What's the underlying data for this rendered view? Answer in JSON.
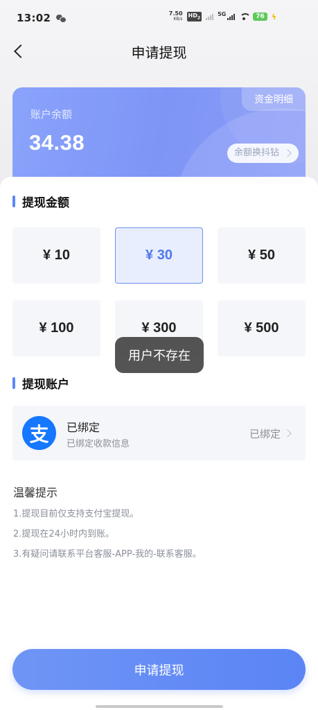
{
  "status_bar": {
    "time": "13:02",
    "net_speed_value": "7.50",
    "net_speed_unit": "KB/s",
    "hd_label": "HD",
    "hd_sub": "2",
    "network_label": "5G",
    "battery": "76"
  },
  "nav": {
    "title": "申请提现"
  },
  "balance_card": {
    "detail_label": "资金明细",
    "balance_label": "账户余额",
    "balance_value": "34.38",
    "exchange_label": "余额换抖钻"
  },
  "amount_section": {
    "title": "提现金额",
    "options": [
      "¥ 10",
      "¥ 30",
      "¥ 50",
      "¥ 100",
      "¥ 300",
      "¥ 500"
    ],
    "selected_index": 1
  },
  "account_section": {
    "title": "提现账户",
    "icon_glyph": "支",
    "account_title": "已绑定",
    "account_sub": "已绑定收款信息",
    "status": "已绑定"
  },
  "tips": {
    "title": "温馨提示",
    "items": [
      "1.提现目前仅支持支付宝提现。",
      "2.提现在24小时内到账。",
      "3.有疑问请联系平台客服-APP-我的-联系客服。"
    ]
  },
  "toast": {
    "message": "用户不存在"
  },
  "submit": {
    "label": "申请提现"
  },
  "colors": {
    "accent": "#5b84f5",
    "card": "#8aa3fb",
    "alipay": "#1677ff"
  }
}
